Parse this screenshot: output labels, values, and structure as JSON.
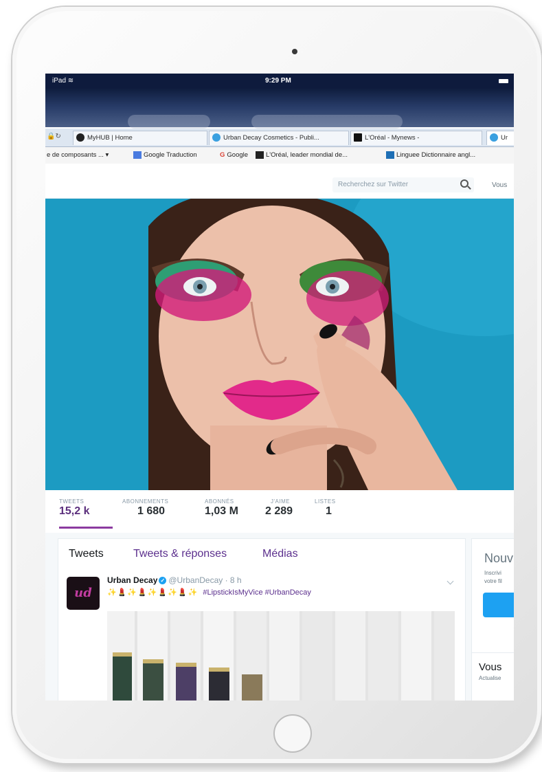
{
  "statusbar": {
    "device": "iPad",
    "time": "9:29 PM"
  },
  "browser": {
    "tabs": [
      {
        "label": "MyHUB | Home",
        "color": "#222222"
      },
      {
        "label": "Urban Decay Cosmetics - Publi...",
        "color": "#3aa0e0"
      },
      {
        "label": "L'Oréal - Mynews -",
        "color": "#111111"
      },
      {
        "label": "Ur",
        "color": "#3aa0e0"
      }
    ],
    "bookmarks": [
      {
        "label": "e de composants ... ▾",
        "color": "#888888"
      },
      {
        "label": "Google Traduction",
        "color": "#4a7be0"
      },
      {
        "label": "Google",
        "color": "#db4437"
      },
      {
        "label": "L'Oréal, leader mondial de...",
        "color": "#222222"
      },
      {
        "label": "Linguee Dictionnaire angl...",
        "color": "#1f6fb5"
      }
    ]
  },
  "twitter": {
    "search_placeholder": "Recherchez sur Twitter",
    "you_link": "Vous",
    "stats": [
      {
        "label": "TWEETS",
        "value": "15,2 k"
      },
      {
        "label": "ABONNEMENTS",
        "value": "1 680"
      },
      {
        "label": "ABONNÉS",
        "value": "1,03 M"
      },
      {
        "label": "J'AIME",
        "value": "2 289"
      },
      {
        "label": "LISTES",
        "value": "1"
      }
    ],
    "timeline_tabs": [
      "Tweets",
      "Tweets & réponses",
      "Médias"
    ],
    "tweet": {
      "avatar_text": "ud",
      "name": "Urban Decay",
      "handle": "@UrbanDecay · 8 h",
      "emojis": "✨💄✨💄✨💄✨💄✨",
      "hashtags": "#LipstickIsMyVice #UrbanDecay"
    },
    "sidebar": {
      "heading": "Nouv",
      "line1": "Inscrivi",
      "line2": "votre fil",
      "card2_heading": "Vous",
      "card2_sub": "Actualise"
    }
  }
}
